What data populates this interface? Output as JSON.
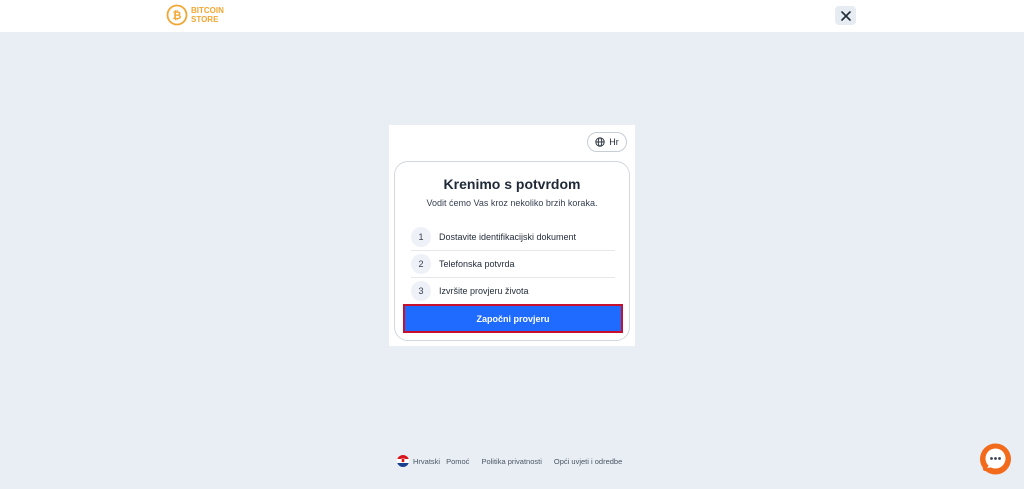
{
  "header": {
    "logo": {
      "line1": "BITCOIN",
      "line2": "STORE",
      "icon": "bitcoin-icon"
    },
    "close_icon": "close-icon"
  },
  "language_button": {
    "label": "Hr",
    "icon": "globe-icon"
  },
  "card": {
    "title": "Krenimo s potvrdom",
    "subtitle": "Vodit ćemo Vas kroz nekoliko brzih koraka.",
    "steps": [
      {
        "number": "1",
        "label": "Dostavite identifikacijski dokument"
      },
      {
        "number": "2",
        "label": "Telefonska potvrda"
      },
      {
        "number": "3",
        "label": "Izvršite provjeru života"
      }
    ],
    "start_button": "Započni provjeru"
  },
  "footer": {
    "language": "Hrvatski",
    "flag_icon": "croatia-flag-icon",
    "links": [
      "Pomoć",
      "Politika privatnosti",
      "Opći uvjeti i odredbe"
    ]
  },
  "chat_icon": "chat-icon",
  "colors": {
    "background": "#e9eef4",
    "primary": "#1f6bff",
    "highlight_border": "#c8102e",
    "logo": "#f3a632",
    "chat": "#f26b1d"
  }
}
